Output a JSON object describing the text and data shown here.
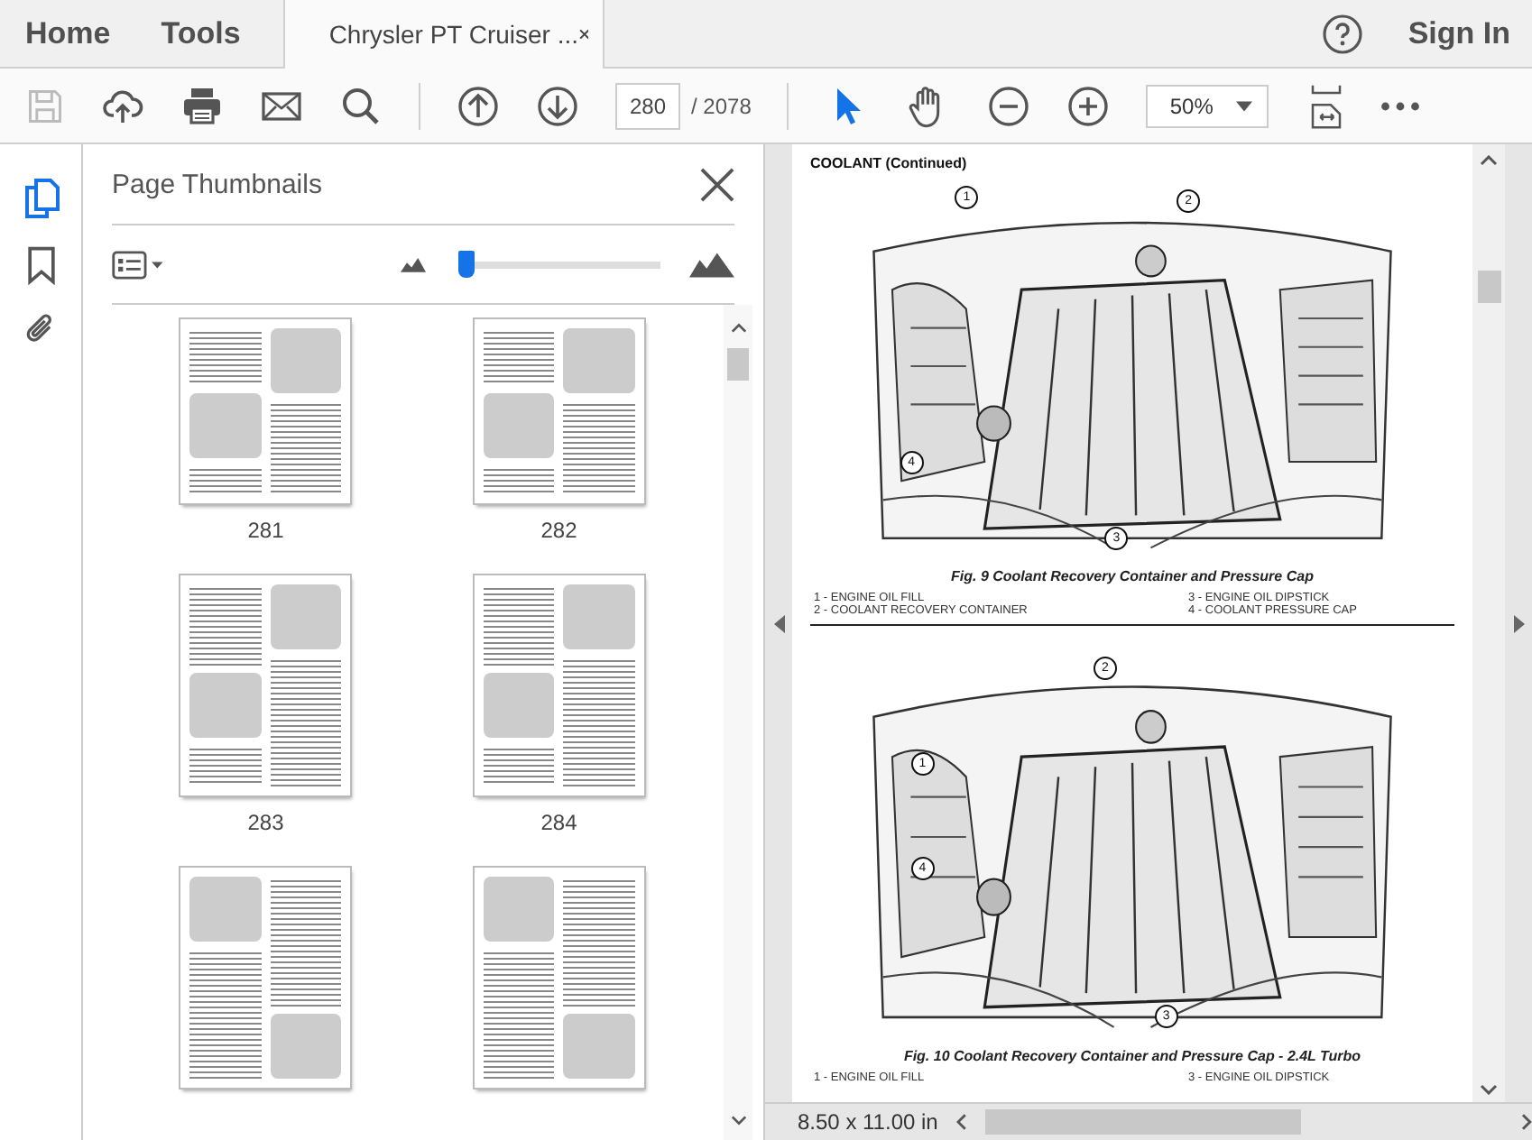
{
  "tabs": [
    {
      "label": "Home",
      "kind": "nav"
    },
    {
      "label": "Tools",
      "kind": "nav"
    },
    {
      "label": "Chrysler PT Cruiser ...",
      "selected": true,
      "kind": "document"
    }
  ],
  "header_actions": {
    "sign_in": "Sign In"
  },
  "toolbar": {
    "save_disabled": true,
    "page_value": "280",
    "page_total": "/ 2078",
    "tools": [
      {
        "kind": "select",
        "selected": true
      },
      {
        "kind": "hand",
        "selected": false
      }
    ],
    "zoom": "50%"
  },
  "side_rail": [
    {
      "kind": "thumbnails",
      "selected": true
    },
    {
      "kind": "bookmarks",
      "selected": false
    },
    {
      "kind": "attachments",
      "selected": false
    }
  ],
  "thumbnails_panel": {
    "title": "Page Thumbnails",
    "size_slider": {
      "level": 0.02
    },
    "pages": [
      {
        "label": "281"
      },
      {
        "label": "282"
      },
      {
        "label": "283"
      },
      {
        "label": "284"
      }
    ]
  },
  "document": {
    "heading": "COOLANT (Continued)",
    "figures": [
      {
        "callouts": [
          "1",
          "2",
          "3",
          "4"
        ],
        "caption": "Fig. 9 Coolant Recovery Container and Pressure Cap",
        "legend": [
          "1 - ENGINE OIL FILL",
          "3 - ENGINE OIL DIPSTICK",
          "2 - COOLANT RECOVERY CONTAINER",
          "4 - COOLANT PRESSURE CAP"
        ]
      },
      {
        "callouts": [
          "1",
          "2",
          "3",
          "4"
        ],
        "caption": "Fig. 10 Coolant Recovery Container and Pressure Cap - 2.4L Turbo",
        "legend": [
          "1 - ENGINE OIL FILL",
          "3 - ENGINE OIL DIPSTICK"
        ]
      }
    ]
  },
  "status_bar": {
    "page_size": "8.50 x 11.00 in"
  }
}
